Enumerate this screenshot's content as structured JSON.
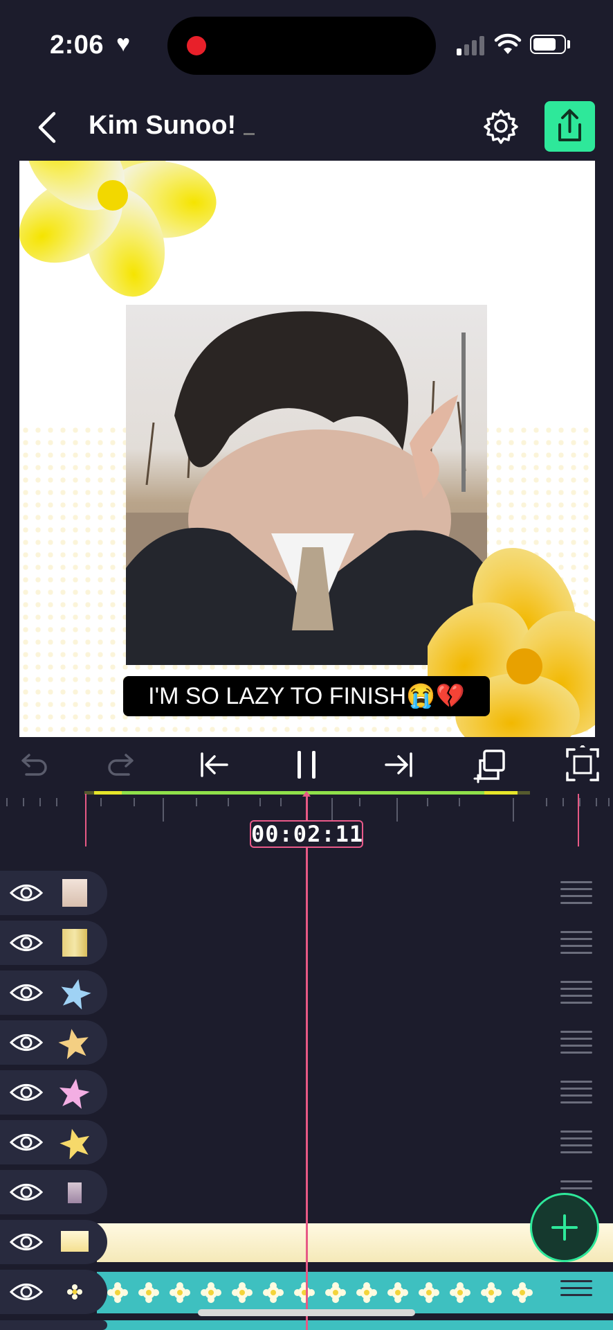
{
  "status_bar": {
    "time": "2:06",
    "heart": "♥"
  },
  "header": {
    "title": "Kim Sunoo!"
  },
  "canvas": {
    "caption": "I'M SO LAZY TO FINISH😭💔"
  },
  "timeline": {
    "timecode": "00:02:11"
  },
  "colors": {
    "accent": "#2ee89a",
    "playhead": "#e75985",
    "background": "#1c1c2c"
  },
  "layers": [
    {
      "icon": "eye-icon",
      "thumb": "photo-thumb"
    },
    {
      "icon": "eye-icon",
      "thumb": "photo-thumb-yellow"
    },
    {
      "icon": "eye-icon",
      "thumb": "blue-star"
    },
    {
      "icon": "eye-icon",
      "thumb": "orange-star"
    },
    {
      "icon": "eye-icon",
      "thumb": "pink-star"
    },
    {
      "icon": "eye-icon",
      "thumb": "yellow-star"
    },
    {
      "icon": "eye-icon",
      "thumb": "small-photo"
    },
    {
      "icon": "eye-icon",
      "thumb": "yellow-rect"
    },
    {
      "icon": "eye-icon",
      "thumb": "flower-sticker"
    }
  ]
}
